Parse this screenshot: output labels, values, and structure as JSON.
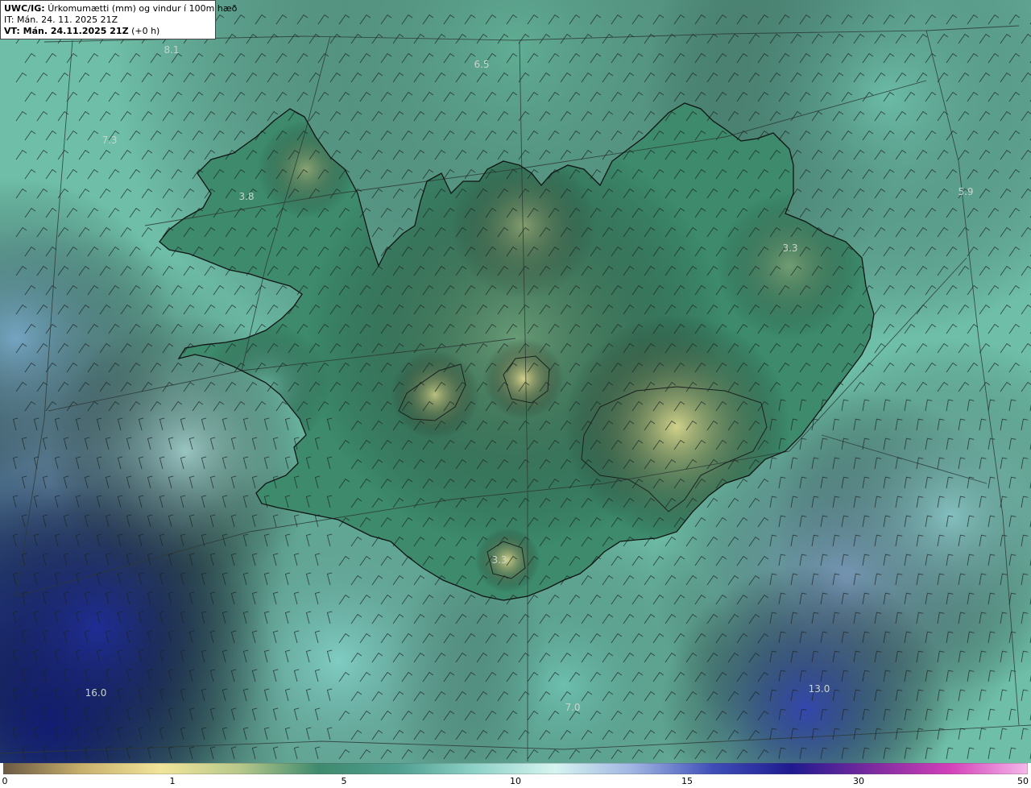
{
  "header": {
    "code": "UWC/IG:",
    "title": "Úrkomumætti (mm) og vindur í 100m hæð",
    "it_line": "IT: Mán. 24. 11. 2025 21Z",
    "vt_label": "VT: Mán. 24.11.2025 21Z",
    "vt_offset": "(+0 h)"
  },
  "map_labels": [
    {
      "id": "label-nw-sea",
      "text": "8.1"
    },
    {
      "id": "label-north-sea",
      "text": "6.5"
    },
    {
      "id": "label-west-sea",
      "text": "7.3"
    },
    {
      "id": "label-westfjords",
      "text": "3.8"
    },
    {
      "id": "label-east-sea",
      "text": "5.9"
    },
    {
      "id": "label-east-land",
      "text": "3.3"
    },
    {
      "id": "label-south-glacier",
      "text": "3.3"
    },
    {
      "id": "label-sw-sea",
      "text": "16.0"
    },
    {
      "id": "label-south-sea",
      "text": "7.0"
    },
    {
      "id": "label-se-sea",
      "text": "13.0"
    }
  ],
  "colorbar": {
    "ticks": [
      "0",
      "1",
      "5",
      "10",
      "15",
      "30",
      "50"
    ],
    "colors": [
      "#6b5a43",
      "#c8b06c",
      "#f1e59a",
      "#b7c88a",
      "#3f8a6e",
      "#4f9e8f",
      "#8fd2c8",
      "#d6f4f0",
      "#9fb4e2",
      "#3f4fb8",
      "#1f1a8f",
      "#7a2a9e",
      "#d23fb8",
      "#f5b8ea"
    ]
  },
  "colors": {
    "sea_low": "#6fbfa8",
    "land_low": "#3d8a6c",
    "land_high": "#e2dc8f",
    "rain_high": "#12208c",
    "coast_line": "#111111",
    "grid_line": "#333333"
  }
}
